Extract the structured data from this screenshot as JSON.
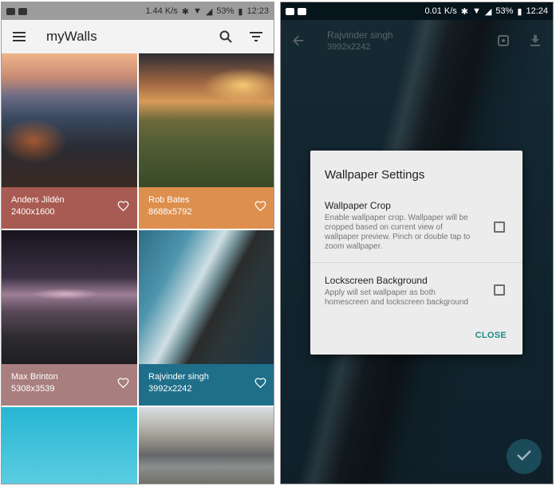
{
  "left": {
    "status": {
      "speed": "1.44 K/s",
      "battery": "53%",
      "time": "12:23"
    },
    "appbar": {
      "title": "myWalls",
      "icons": [
        "menu-icon",
        "search-icon",
        "filter-icon"
      ]
    },
    "cards": [
      {
        "name": "Anders Jildén",
        "dims": "2400x1600",
        "color": "#a85b52"
      },
      {
        "name": "Rob Bates",
        "dims": "8688x5792",
        "color": "#dd8f4e"
      },
      {
        "name": "Max Brinton",
        "dims": "5308x3539",
        "color": "#a97e7e"
      },
      {
        "name": "Rajvinder singh",
        "dims": "3992x2242",
        "color": "#1f6f8a"
      }
    ]
  },
  "right": {
    "status": {
      "speed": "0.01 K/s",
      "battery": "53%",
      "time": "12:24"
    },
    "appbar": {
      "title": "Rajvinder singh",
      "subtitle": "3992x2242"
    },
    "dialog": {
      "title": "Wallpaper Settings",
      "options": [
        {
          "title": "Wallpaper Crop",
          "desc": "Enable wallpaper crop. Wallpaper will be cropped based on current view of wallpaper preview. Pinch or double tap to zoom wallpaper.",
          "checked": false
        },
        {
          "title": "Lockscreen Background",
          "desc": "Apply will set wallpaper as both homescreen and lockscreen background",
          "checked": false
        }
      ],
      "close_label": "CLOSE"
    },
    "accent": "#1e8a88"
  }
}
